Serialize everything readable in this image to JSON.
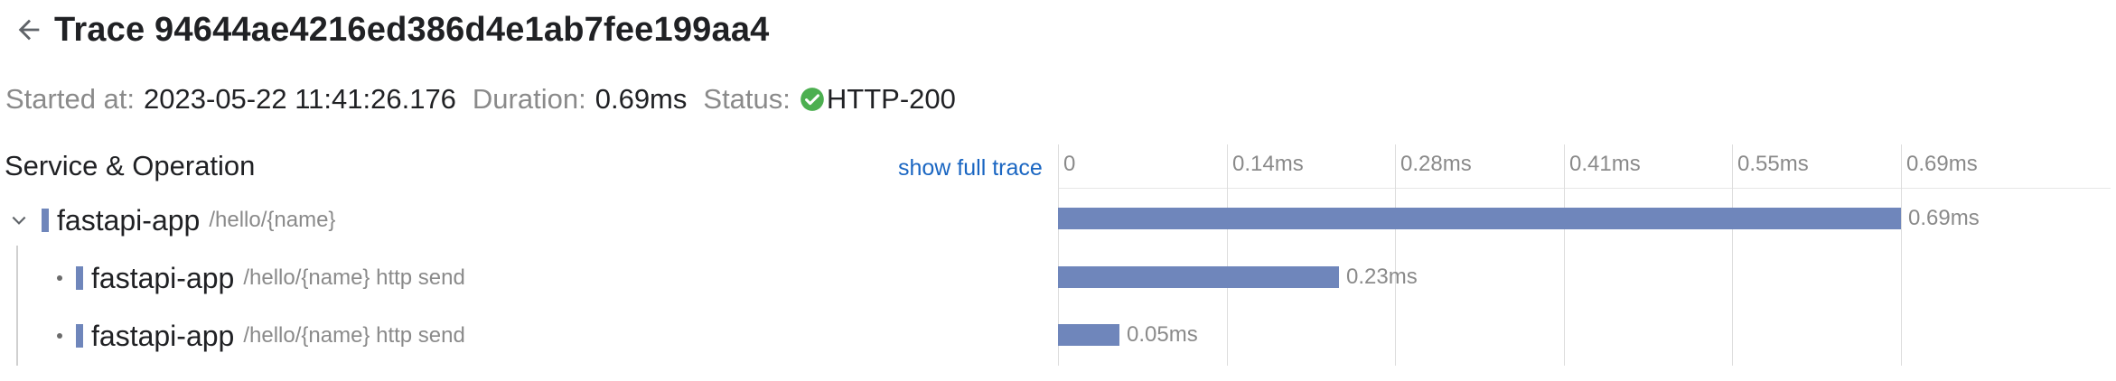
{
  "header": {
    "title": "Trace 94644ae4216ed386d4e1ab7fee199aa4",
    "back_icon": "arrow-left-icon"
  },
  "meta": {
    "started_label": "Started at:",
    "started_value": "2023-05-22 11:41:26.176",
    "duration_label": "Duration:",
    "duration_value": "0.69ms",
    "status_label": "Status:",
    "status_value": "HTTP-200",
    "status_icon": "check-circle-icon",
    "status_color": "#4caf50"
  },
  "tree": {
    "column_header": "Service & Operation",
    "show_full_trace": "show full trace"
  },
  "axis": {
    "ticks": [
      "0",
      "0.14ms",
      "0.28ms",
      "0.41ms",
      "0.55ms",
      "0.69ms"
    ],
    "max_ms": 0.69
  },
  "spans": [
    {
      "service": "fastapi-app",
      "operation": "/hello/{name}",
      "duration_label": "0.69ms",
      "start_ms": 0,
      "duration_ms": 0.69,
      "depth": 0,
      "expand_icon": "chevron-down-icon"
    },
    {
      "service": "fastapi-app",
      "operation": "/hello/{name} http send",
      "duration_label": "0.23ms",
      "start_ms": 0,
      "duration_ms": 0.23,
      "depth": 1
    },
    {
      "service": "fastapi-app",
      "operation": "/hello/{name} http send",
      "duration_label": "0.05ms",
      "start_ms": 0,
      "duration_ms": 0.05,
      "depth": 1
    }
  ],
  "colors": {
    "span_bar": "#6f86bb",
    "link": "#1a66c2"
  }
}
